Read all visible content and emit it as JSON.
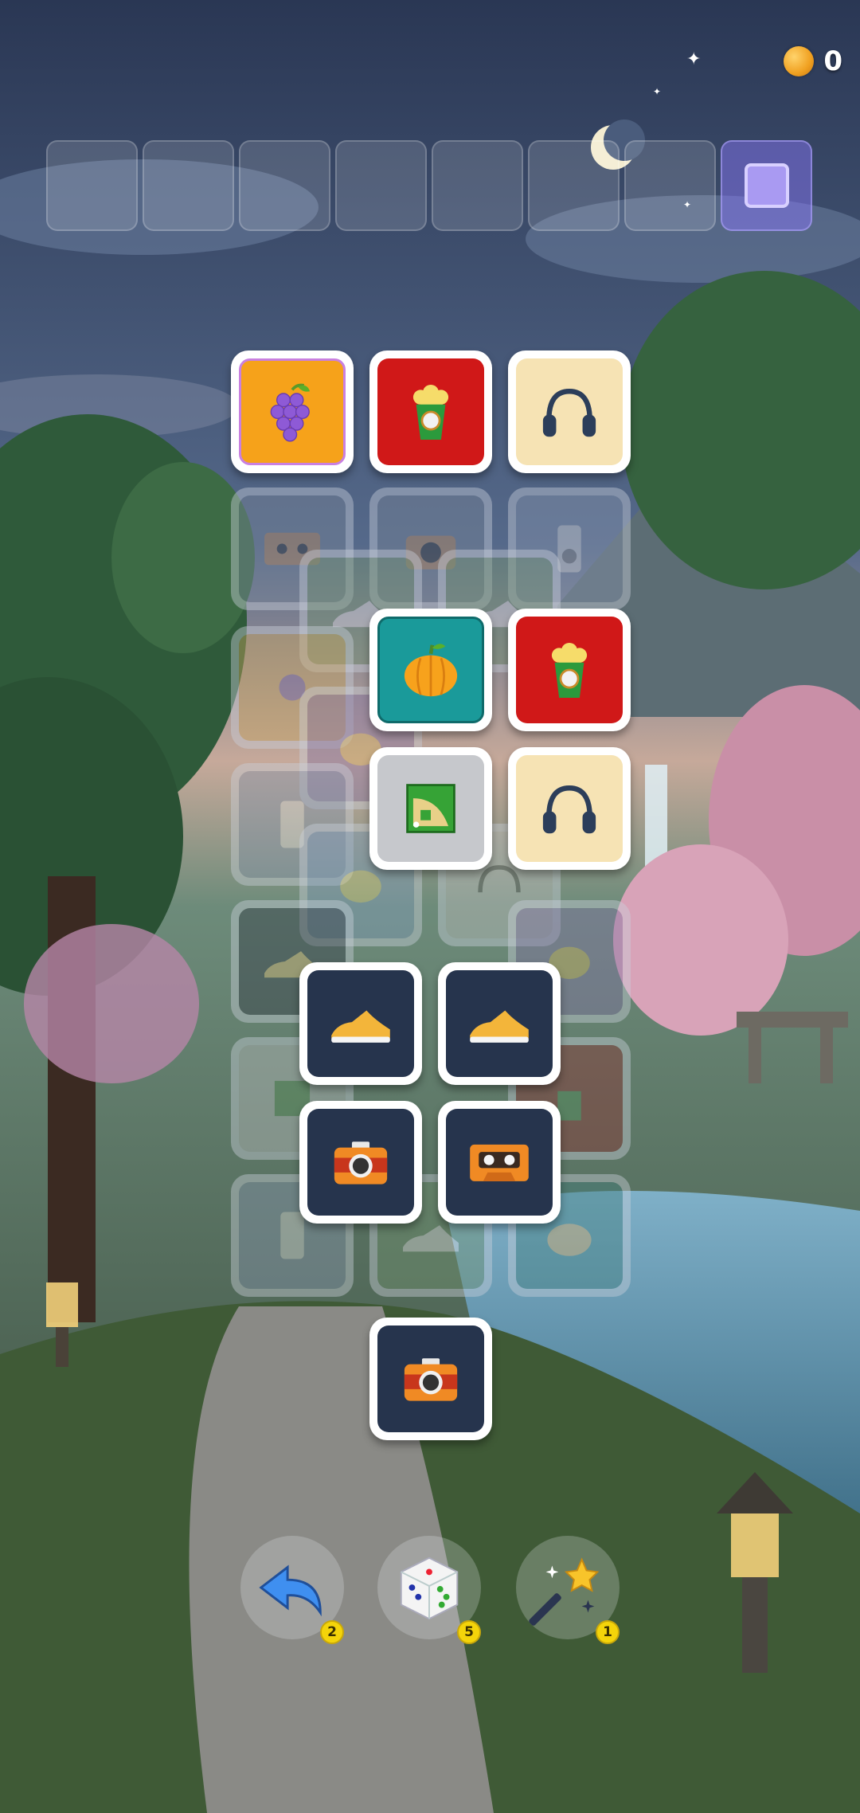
{
  "hud": {
    "coins": "0"
  },
  "slot_bar": {
    "slots": 8
  },
  "boosters": [
    {
      "name": "undo",
      "count": "2"
    },
    {
      "name": "shuffle",
      "count": "5"
    },
    {
      "name": "magic-wand",
      "count": "1"
    }
  ],
  "tiles_top_layer": [
    "grapes",
    "popcorn",
    "headphones",
    "pumpkin",
    "popcorn",
    "baseball-field",
    "headphones",
    "sneaker",
    "sneaker",
    "camera",
    "cassette",
    "camera"
  ],
  "tiles_covered": [
    "cassette",
    "camera",
    "music-player",
    "sneaker",
    "sneaker",
    "grapes",
    "lemon",
    "music-player",
    "lemon",
    "headphones",
    "sneaker",
    "lemon",
    "baseball-field",
    "popcorn",
    "music-player",
    "sneaker",
    "pumpkin"
  ],
  "colors": {
    "accent": "#8c78ff",
    "coin": "#f0a020",
    "badge": "#f4d40a"
  }
}
